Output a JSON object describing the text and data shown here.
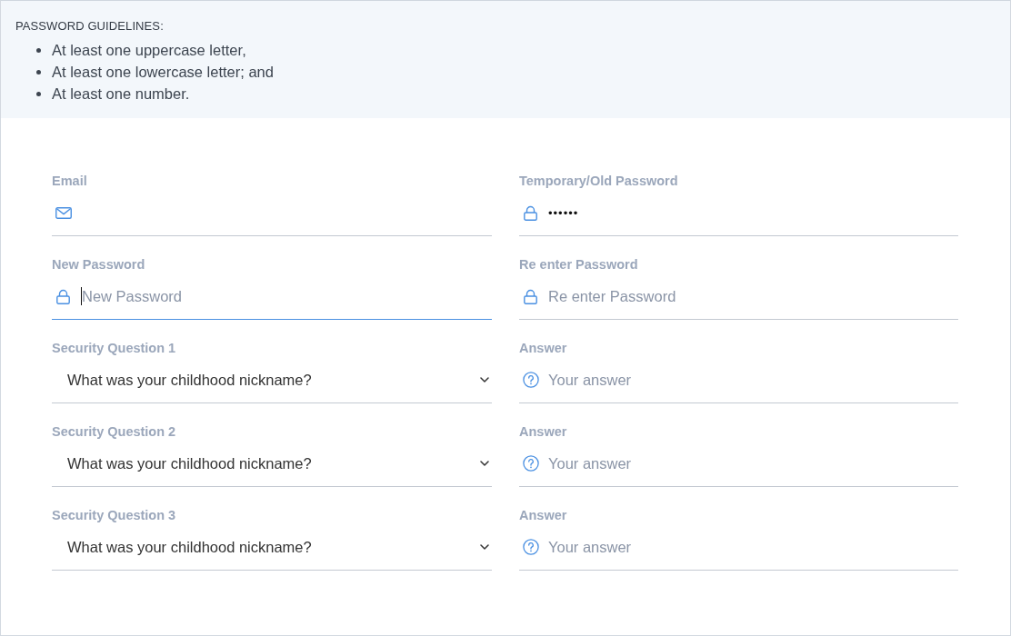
{
  "guidelines": {
    "title": "PASSWORD GUIDELINES:",
    "items": [
      "At least one uppercase letter,",
      "At least one lowercase letter; and",
      "At least one number."
    ]
  },
  "form": {
    "fields": [
      {
        "kind": "email",
        "label": "Email",
        "focused": false
      },
      {
        "kind": "password",
        "label": "Temporary/Old Password",
        "value": "••••••",
        "focused": false
      },
      {
        "kind": "password",
        "label": "New Password",
        "placeholder": "New Password",
        "focused": true
      },
      {
        "kind": "password",
        "label": "Re enter Password",
        "placeholder": "Re enter Password",
        "focused": false
      },
      {
        "kind": "select",
        "label": "Security Question 1",
        "value": "What was your childhood nickname?",
        "focused": false
      },
      {
        "kind": "answer",
        "label": "Answer",
        "placeholder": "Your answer",
        "focused": false
      },
      {
        "kind": "select",
        "label": "Security Question 2",
        "value": "What was your childhood nickname?",
        "focused": false
      },
      {
        "kind": "answer",
        "label": "Answer",
        "placeholder": "Your answer",
        "focused": false
      },
      {
        "kind": "select",
        "label": "Security Question 3",
        "value": "What was your childhood nickname?",
        "focused": false
      },
      {
        "kind": "answer",
        "label": "Answer",
        "placeholder": "Your answer",
        "focused": false
      }
    ]
  }
}
